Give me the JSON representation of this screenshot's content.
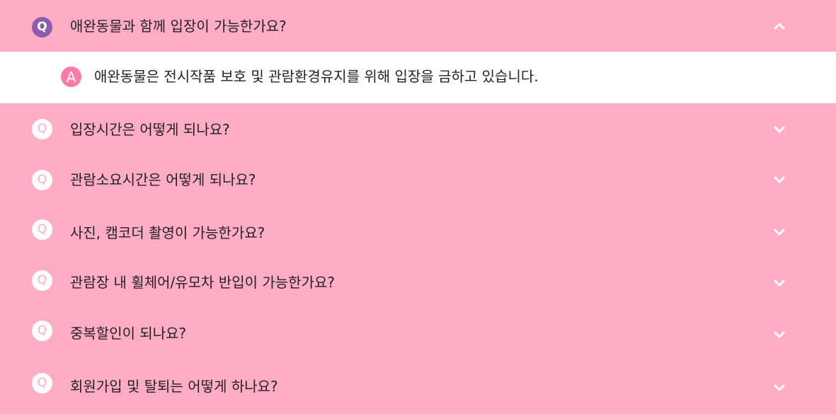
{
  "faq": {
    "q_marker": "Q",
    "a_marker": "A",
    "colors": {
      "background": "#FFADC5",
      "answer_background": "#FFFFFF",
      "open_badge": "#8E5BAE",
      "answer_badge": "#FF7AA6",
      "text": "#222222"
    },
    "items": [
      {
        "question": "애완동물과 함께 입장이 가능한가요?",
        "answer": "애완동물은 전시작품 보호 및 관람환경유지를 위해 입장을 금하고 있습니다.",
        "expanded": true,
        "icon": "chevron-up-icon"
      },
      {
        "question": "입장시간은 어떻게 되나요?",
        "expanded": false,
        "icon": "chevron-down-icon"
      },
      {
        "question": "관람소요시간은 어떻게 되나요?",
        "expanded": false,
        "icon": "chevron-down-icon"
      },
      {
        "question": "사진, 캠코더 촬영이 가능한가요?",
        "expanded": false,
        "icon": "chevron-down-icon"
      },
      {
        "question": "관람장 내 휠체어/유모차 반입이 가능한가요?",
        "expanded": false,
        "icon": "chevron-down-icon"
      },
      {
        "question": "중복할인이 되나요?",
        "expanded": false,
        "icon": "chevron-down-icon"
      },
      {
        "question": "회원가입 및 탈퇴는 어떻게 하나요?",
        "expanded": false,
        "icon": "chevron-down-icon"
      }
    ]
  }
}
